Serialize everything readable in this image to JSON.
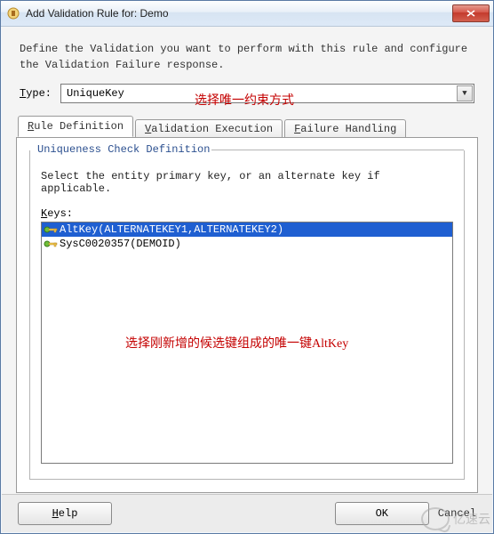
{
  "titlebar": {
    "title": "Add Validation Rule for: Demo"
  },
  "description": "Define the Validation you want to perform with this rule and configure the Validation Failure response.",
  "type": {
    "label_pre": "T",
    "label_post": "ype:",
    "value": "UniqueKey"
  },
  "annotation1": "选择唯一约束方式",
  "tabs": [
    {
      "pre": "R",
      "post": "ule Definition",
      "active": true
    },
    {
      "pre": "V",
      "post": "alidation Execution",
      "active": false
    },
    {
      "pre": "F",
      "post": "ailure Handling",
      "active": false
    }
  ],
  "group": {
    "title": "Uniqueness Check Definition",
    "desc": "Select the entity primary key, or an alternate key if applicable.",
    "keys_label_pre": "K",
    "keys_label_post": "eys:",
    "items": [
      {
        "label": "AltKey(ALTERNATEKEY1,ALTERNATEKEY2)",
        "selected": true
      },
      {
        "label": "SysC0020357(DEMOID)",
        "selected": false
      }
    ]
  },
  "annotation2": "选择刚新增的候选键组成的唯一键AltKey",
  "buttons": {
    "help_pre": "H",
    "help_post": "elp",
    "ok": "OK",
    "cancel_partial": "Cancel"
  },
  "watermark": "亿速云"
}
